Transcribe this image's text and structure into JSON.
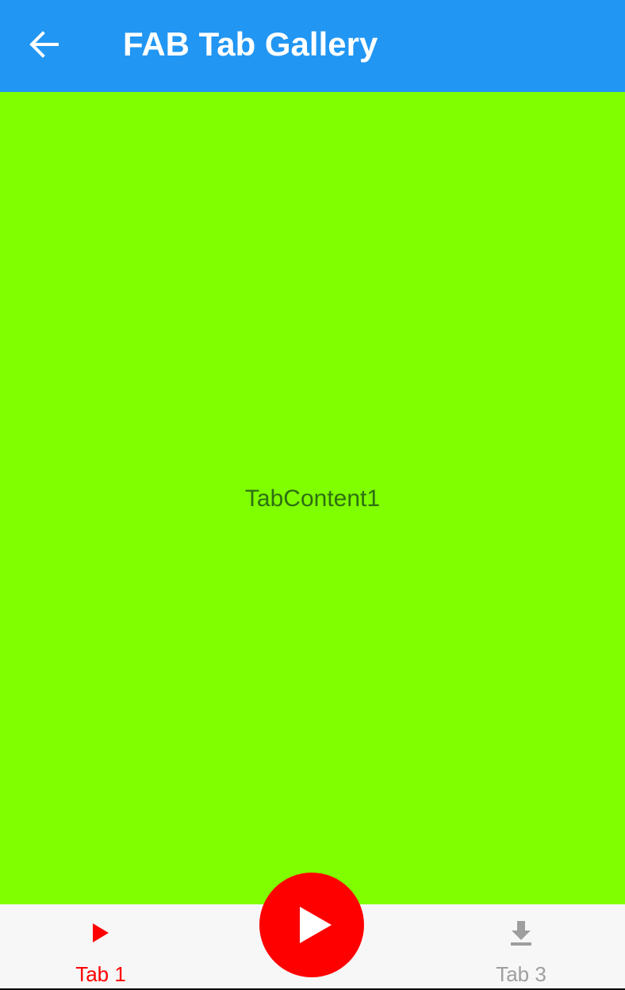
{
  "app_bar": {
    "title": "FAB Tab Gallery",
    "back_icon": "arrow-back-icon",
    "color": "#2196F3"
  },
  "content": {
    "text": "TabContent1",
    "background": "#80FF00"
  },
  "tabs": [
    {
      "label": "Tab 1",
      "icon": "play-icon",
      "selected": true,
      "color": "#FF0000"
    },
    {
      "label": "",
      "icon": "play-icon",
      "is_fab": true,
      "color": "#FF0000"
    },
    {
      "label": "Tab 3",
      "icon": "download-icon",
      "selected": false,
      "color": "#9E9E9E"
    }
  ]
}
